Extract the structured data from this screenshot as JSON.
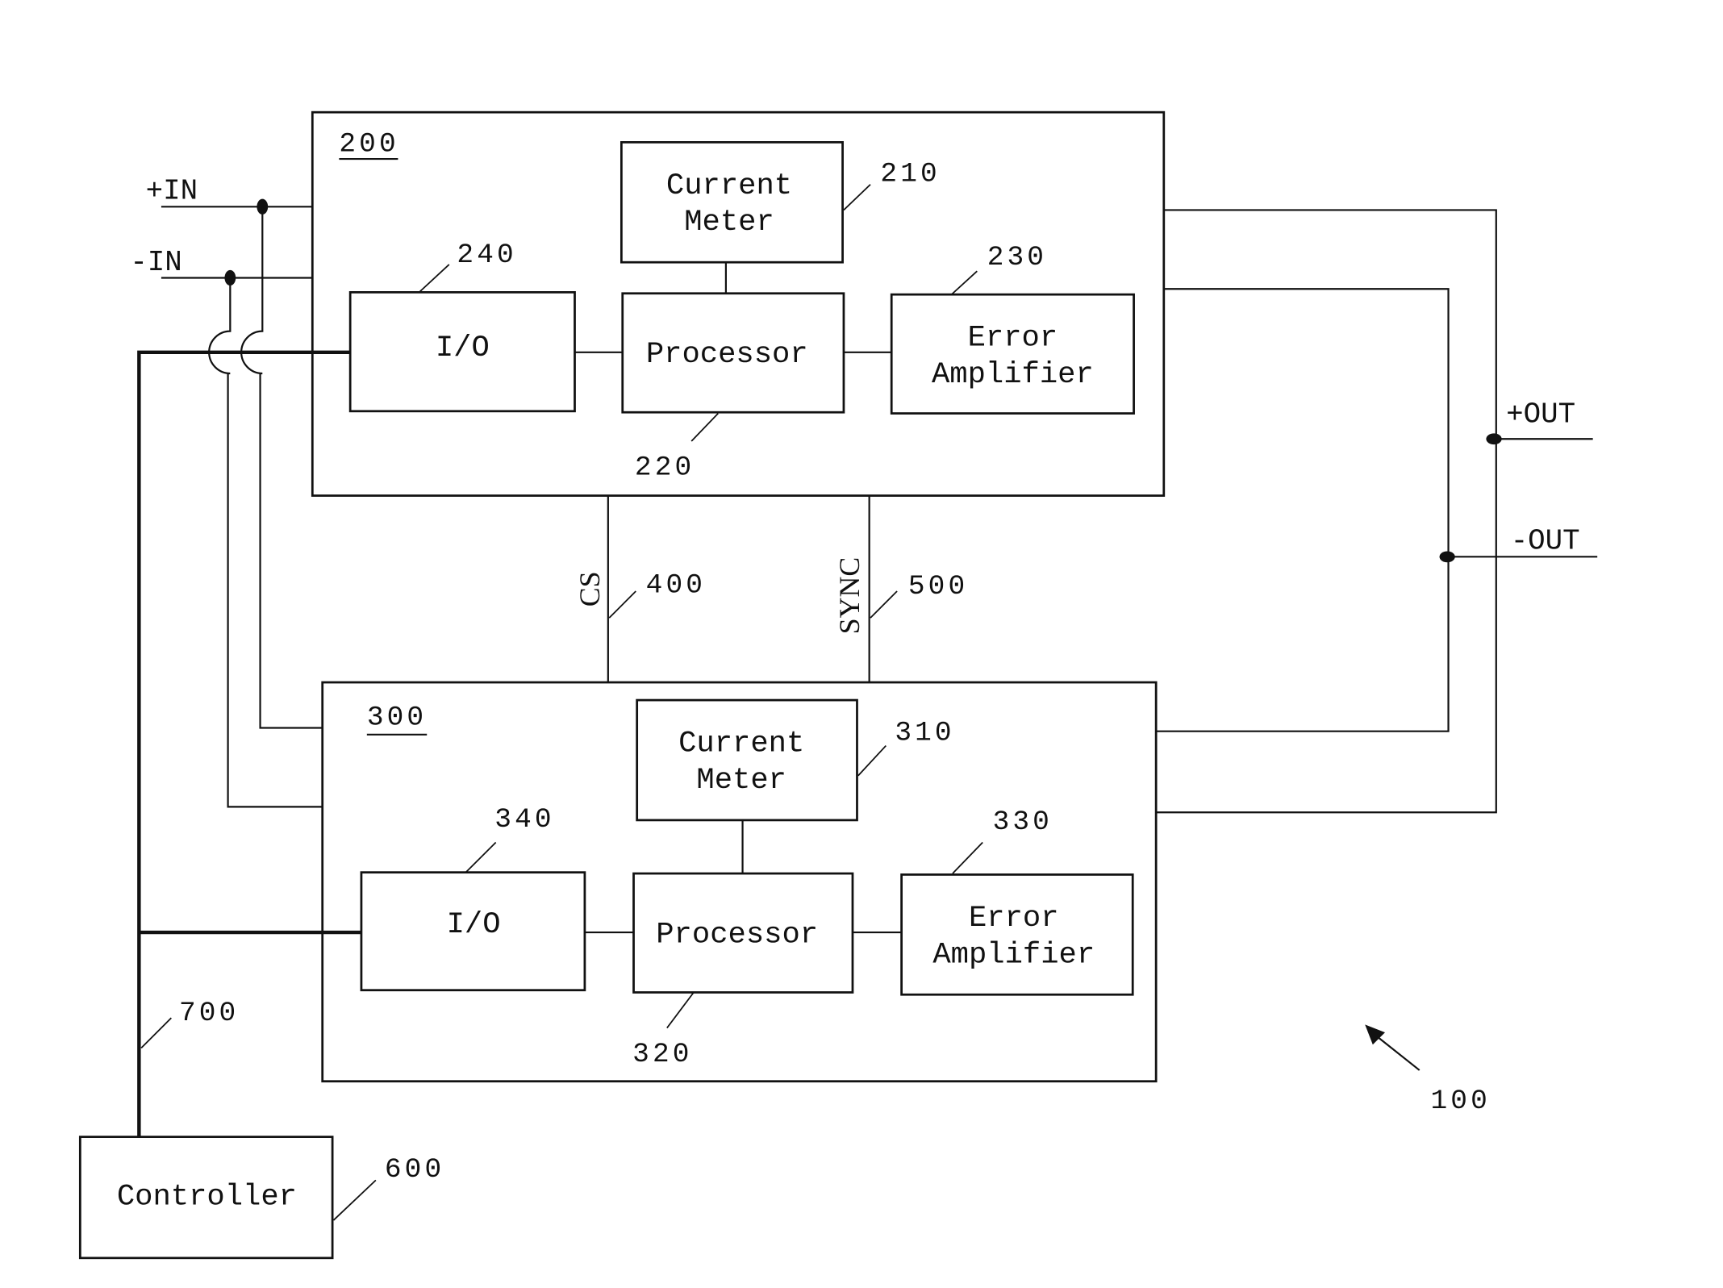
{
  "diagram": {
    "system_ref": "100",
    "inputs": {
      "positive": "+IN",
      "negative": "-IN"
    },
    "outputs": {
      "positive": "+OUT",
      "negative": "-OUT"
    },
    "modules": [
      {
        "ref": "200",
        "blocks": {
          "current_meter": {
            "ref": "210",
            "line1": "Current",
            "line2": "Meter"
          },
          "processor": {
            "ref": "220",
            "label": "Processor"
          },
          "error_amplifier": {
            "ref": "230",
            "line1": "Error",
            "line2": "Amplifier"
          },
          "io": {
            "ref": "240",
            "label": "I/O"
          }
        }
      },
      {
        "ref": "300",
        "blocks": {
          "current_meter": {
            "ref": "310",
            "line1": "Current",
            "line2": "Meter"
          },
          "processor": {
            "ref": "320",
            "label": "Processor"
          },
          "error_amplifier": {
            "ref": "330",
            "line1": "Error",
            "line2": "Amplifier"
          },
          "io": {
            "ref": "340",
            "label": "I/O"
          }
        }
      }
    ],
    "signals": {
      "cs": {
        "label": "CS",
        "ref": "400"
      },
      "sync": {
        "label": "SYNC",
        "ref": "500"
      }
    },
    "controller": {
      "label": "Controller",
      "ref": "600"
    },
    "control_bus": {
      "ref": "700"
    }
  }
}
